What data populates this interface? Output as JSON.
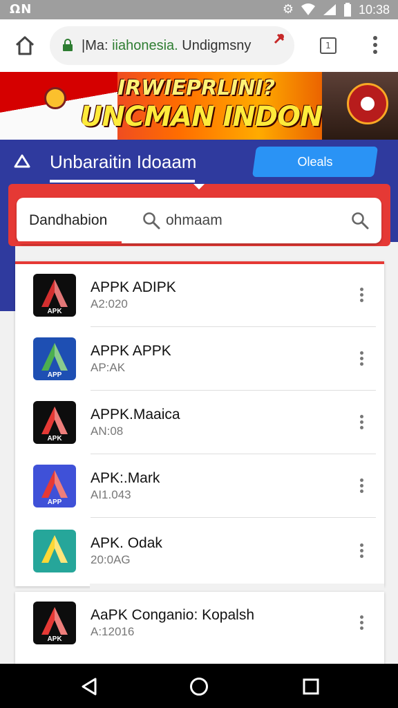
{
  "status_bar": {
    "left_indicators": "ΩΝ",
    "time": "10:38"
  },
  "browser": {
    "url_prefix": "|Ma: ",
    "url_domain": "iiahonesia.",
    "url_suffix": " Undigmsny",
    "tab_count": "1"
  },
  "banner": {
    "line1": "IRWIEPRLINI?",
    "line2": "UNCMAN INDONSIA"
  },
  "nav": {
    "title": "Unbaraitin Idoaam",
    "button_label": "Oleals"
  },
  "search": {
    "label": "Dandhabion",
    "value": "ohmaam"
  },
  "apps": [
    {
      "name": "APPK ADIPK",
      "sub": "A2:020",
      "icon_letters": "APK",
      "bg": "#0d0d0d",
      "accent": "#d32f2f"
    },
    {
      "name": "APPK APPK",
      "sub": "AP:AK",
      "icon_letters": "APP",
      "bg": "#1e4fb3",
      "accent": "#4caf50"
    },
    {
      "name": "APPK.Maaica",
      "sub": "AN:08",
      "icon_letters": "APK",
      "bg": "#0d0d0d",
      "accent": "#e53935"
    },
    {
      "name": "APK:.Mark",
      "sub": "AI1.043",
      "icon_letters": "APP",
      "bg": "#3f51d8",
      "accent": "#e53935"
    },
    {
      "name": "APK. Odak",
      "sub": "20:0AG",
      "icon_letters": "",
      "bg": "#26a69a",
      "accent": "#fdd835"
    },
    {
      "name": "AaPK Conganio: Kopalsh",
      "sub": "A:12016",
      "icon_letters": "APK",
      "bg": "#0d0d0d",
      "accent": "#e53935"
    }
  ],
  "colors": {
    "nav_band": "#2f3a9e",
    "accent_red": "#e53935",
    "button_blue": "#2a93f5"
  }
}
